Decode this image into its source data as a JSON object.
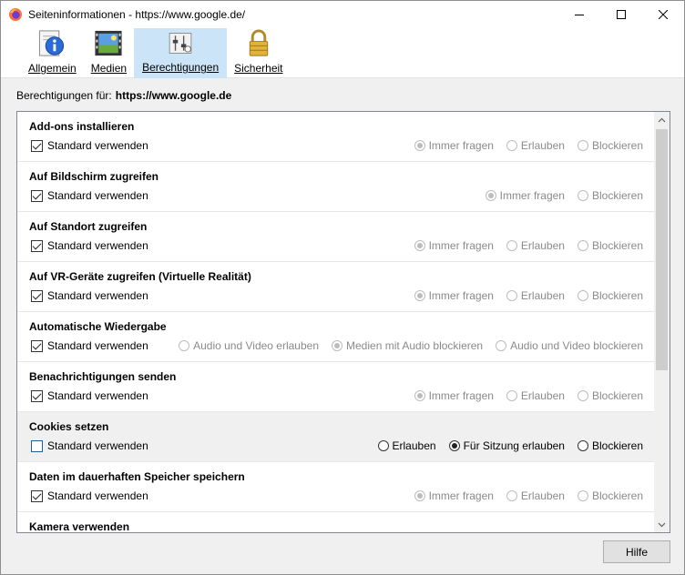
{
  "window": {
    "title": "Seiteninformationen - https://www.google.de/"
  },
  "tabs": [
    {
      "label": "Allgemein",
      "icon": "info-icon"
    },
    {
      "label": "Medien",
      "icon": "media-icon"
    },
    {
      "label": "Berechtigungen",
      "icon": "permissions-icon"
    },
    {
      "label": "Sicherheit",
      "icon": "lock-icon"
    }
  ],
  "permissions_for": {
    "label": "Berechtigungen für:",
    "host": "https://www.google.de"
  },
  "std_label": "Standard verwenden",
  "permissions": [
    {
      "title": "Add-ons installieren",
      "std_checked": true,
      "options": [
        "Immer fragen",
        "Erlauben",
        "Blockieren"
      ],
      "selected": 0
    },
    {
      "title": "Auf Bildschirm zugreifen",
      "std_checked": true,
      "options": [
        "Immer fragen",
        "Blockieren"
      ],
      "selected": 0
    },
    {
      "title": "Auf Standort zugreifen",
      "std_checked": true,
      "options": [
        "Immer fragen",
        "Erlauben",
        "Blockieren"
      ],
      "selected": 0
    },
    {
      "title": "Auf VR-Geräte zugreifen (Virtuelle Realität)",
      "std_checked": true,
      "options": [
        "Immer fragen",
        "Erlauben",
        "Blockieren"
      ],
      "selected": 0
    },
    {
      "title": "Automatische Wiedergabe",
      "std_checked": true,
      "options": [
        "Audio und Video erlauben",
        "Medien mit Audio blockieren",
        "Audio und Video blockieren"
      ],
      "selected": 1
    },
    {
      "title": "Benachrichtigungen senden",
      "std_checked": true,
      "options": [
        "Immer fragen",
        "Erlauben",
        "Blockieren"
      ],
      "selected": 0
    },
    {
      "title": "Cookies setzen",
      "std_checked": false,
      "options": [
        "Erlauben",
        "Für Sitzung erlauben",
        "Blockieren"
      ],
      "selected": 1
    },
    {
      "title": "Daten im dauerhaften Speicher speichern",
      "std_checked": true,
      "options": [
        "Immer fragen",
        "Erlauben",
        "Blockieren"
      ],
      "selected": 0
    },
    {
      "title": "Kamera verwenden",
      "std_checked": true,
      "options": [],
      "selected": -1
    }
  ],
  "help_button": "Hilfe",
  "colors": {
    "selected_tab": "#cce4f7",
    "highlight_row": "#f0f0f0"
  }
}
